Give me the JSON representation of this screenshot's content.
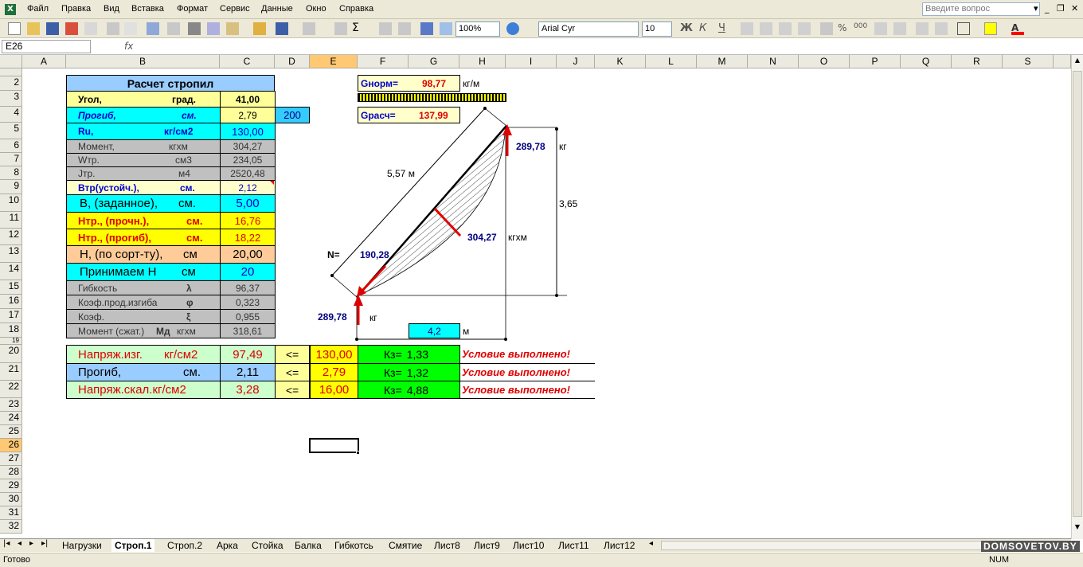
{
  "menu": [
    "Файл",
    "Правка",
    "Вид",
    "Вставка",
    "Формат",
    "Сервис",
    "Данные",
    "Окно",
    "Справка"
  ],
  "help_placeholder": "Введите вопрос",
  "toolbar": {
    "zoom": "100%",
    "font": "Arial Cyr",
    "size": "10"
  },
  "name_box": "E26",
  "fx": "fx",
  "columns": [
    "A",
    "B",
    "C",
    "D",
    "E",
    "F",
    "G",
    "H",
    "I",
    "J",
    "K",
    "L",
    "M",
    "N",
    "O",
    "P",
    "Q",
    "R",
    "S"
  ],
  "rows": [
    "2",
    "3",
    "4",
    "5",
    "6",
    "7",
    "8",
    "9",
    "10",
    "11",
    "12",
    "13",
    "14",
    "15",
    "16",
    "17",
    "18",
    "19",
    "20",
    "21",
    "22",
    "23",
    "24",
    "25",
    "26",
    "27",
    "28",
    "29",
    "30",
    "31",
    "32"
  ],
  "calc": {
    "title": "Расчет стропил",
    "ugol_label": "Угол,",
    "ugol_unit": "град.",
    "ugol_val": "41,00",
    "progib_label": "Прогиб,",
    "progib_unit": "см.",
    "progib_val": "2,79",
    "progib_extra": "200",
    "ru_label": "Ru,",
    "ru_unit": "кг/см2",
    "ru_val": "130,00",
    "moment_label": "Момент,",
    "moment_unit": "кгхм",
    "moment_val": "304,27",
    "wtr_label": "Wтр.",
    "wtr_unit": "см3",
    "wtr_val": "234,05",
    "jtr_label": "Jтр.",
    "jtr_unit": "м4",
    "jtr_val": "2520,48",
    "btr_label": "Втр(устойч.),",
    "btr_unit": "см.",
    "btr_val": "2,12",
    "b_label": "В, (заданное),",
    "b_unit": "см.",
    "b_val": "5,00",
    "htr1_label": "Нтр., (прочн.),",
    "htr1_unit": "см.",
    "htr1_val": "16,76",
    "htr2_label": "Нтр., (прогиб),",
    "htr2_unit": "см.",
    "htr2_val": "18,22",
    "hsort_label": "Н, (по сорт-ту),",
    "hsort_unit": "см",
    "hsort_val": "20,00",
    "hprin_label": "Принимаем Н",
    "hprin_unit": "см",
    "hprin_val": "20",
    "gibk_label": "Гибкость",
    "gibk_sym": "λ",
    "gibk_val": "96,37",
    "kpi_label": "Коэф.прод.изгиба",
    "kpi_sym": "φ",
    "kpi_val": "0,323",
    "koef_label": "Коэф.",
    "koef_sym": "ξ",
    "koef_val": "0,955",
    "msz_label": "Момент (сжат.)",
    "msz_sym": "Мд",
    "msz_unit": "кгхм",
    "msz_val": "318,61"
  },
  "check": [
    {
      "label": "Напряж.изг.",
      "unit": "кг/см2",
      "val": "97,49",
      "op": "<=",
      "limit": "130,00",
      "kz": "Кз=",
      "kzv": "1,33",
      "msg": "Условие выполнено!"
    },
    {
      "label": "Прогиб,",
      "unit": "см.",
      "val": "2,11",
      "op": "<=",
      "limit": "2,79",
      "kz": "Кз=",
      "kzv": "1,32",
      "msg": "Условие выполнено!"
    },
    {
      "label": "Напряж.скал.кг/см2",
      "unit": "",
      "val": "3,28",
      "op": "<=",
      "limit": "16,00",
      "kz": "Кз=",
      "kzv": "4,88",
      "msg": "Условие выполнено!"
    }
  ],
  "diagram": {
    "gnorm_label": "Gнорм=",
    "gnorm_val": "98,77",
    "gnorm_unit": "кг/м",
    "grasch_label": "Gрасч=",
    "grasch_val": "137,99",
    "top_force": "289,78",
    "top_unit": "кг",
    "length": "5,57 м",
    "height": "3,65",
    "moment": "304,27",
    "moment_unit": "кгхм",
    "n_label": "N=",
    "n_val": "190,28",
    "bot_force": "289,78",
    "bot_unit": "кг",
    "span": "4,2",
    "span_unit": "м"
  },
  "tabs": [
    "Нагрузки",
    "Строп.1",
    "Строп.2",
    "Арка",
    "Стойка",
    "Балка",
    "Гибкотсь",
    "Смятие",
    "Лист8",
    "Лист9",
    "Лист10",
    "Лист11",
    "Лист12"
  ],
  "active_tab": "Строп.1",
  "status": {
    "ready": "Готово",
    "num": "NUM"
  },
  "watermark": "DOMSOVETOV.BY",
  "colors": {
    "title_bg": "#99CCFF",
    "yellow": "#FFFF99",
    "cyan": "#00FFFF",
    "gray": "#C0C0C0",
    "bright_yellow": "#FFFF00",
    "peach": "#FFCC99",
    "green": "#00FF00",
    "light_green": "#CCFFCC",
    "red": "#FF0000",
    "blue": "#000080"
  }
}
